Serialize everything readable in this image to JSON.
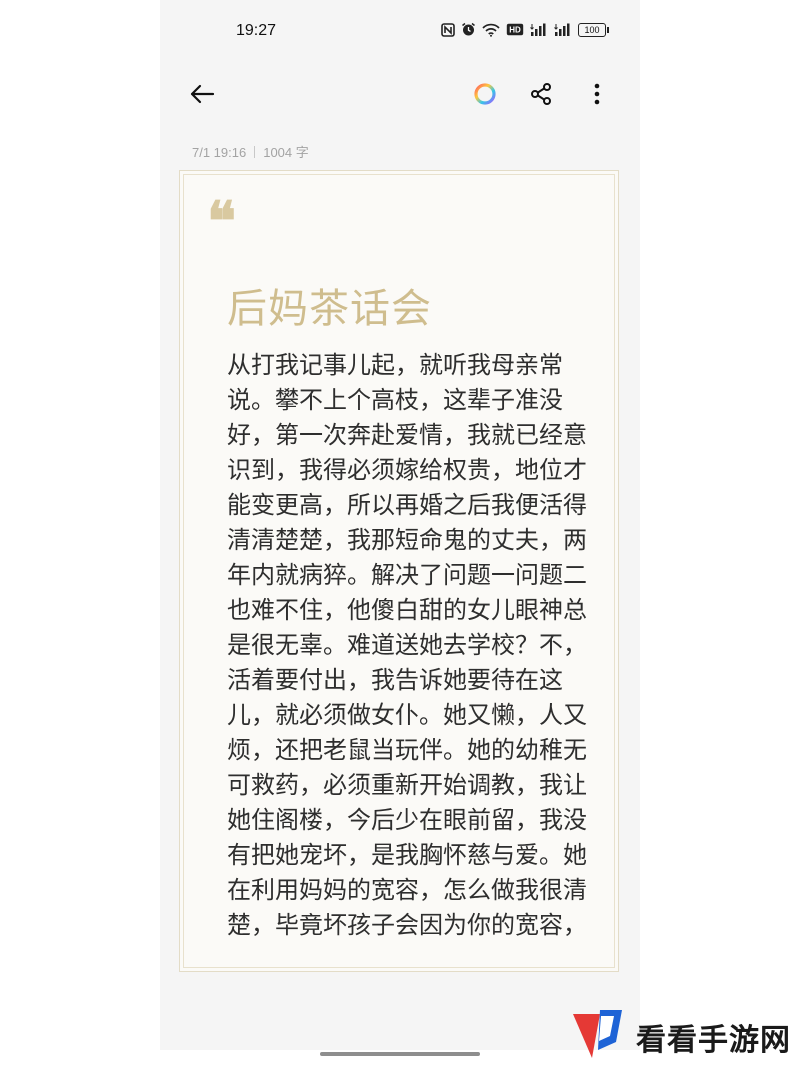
{
  "status_bar": {
    "time": "19:27",
    "icons": [
      "nfc-icon",
      "alarm-icon",
      "wifi-icon",
      "hd-icon",
      "signal-icon",
      "signal-icon",
      "battery-icon"
    ],
    "hd_label": "HD",
    "battery_label": "100"
  },
  "toolbar": {
    "back": "back-arrow-icon",
    "color_picker": "color-ring-icon",
    "share": "share-icon",
    "more": "more-vertical-icon"
  },
  "note_meta": {
    "datetime": "7/1 19:16",
    "word_count": "1004 字"
  },
  "card": {
    "quote_mark": "❝",
    "title": "后妈茶话会",
    "body_lines": [
      "从打我记事儿起，就听我母亲常",
      "说。攀不上个高枝，这辈子准没",
      "好，第一次奔赴爱情，我就已经意",
      "识到，我得必须嫁给权贵，地位才",
      "能变更高，所以再婚之后我便活得",
      "清清楚楚，我那短命鬼的丈夫，两",
      "年内就病猝。解决了问题一问题二",
      "也难不住，他傻白甜的女儿眼神总",
      "是很无辜。难道送她去学校？不，",
      "活着要付出，我告诉她要待在这",
      "儿，就必须做女仆。她又懒，人又",
      "烦，还把老鼠当玩伴。她的幼稚无",
      "可救药，必须重新开始调教，我让",
      "她住阁楼，今后少在眼前留，我没",
      "有把她宠坏，是我胸怀慈与爱。她",
      "在利用妈妈的宽容，怎么做我很清",
      "楚，毕竟坏孩子会因为你的宽容，"
    ],
    "accent_color": "#cfbd8e"
  },
  "watermark": {
    "text": "看看手游网",
    "logo_colors": [
      "#e53935",
      "#1e63d6"
    ]
  }
}
